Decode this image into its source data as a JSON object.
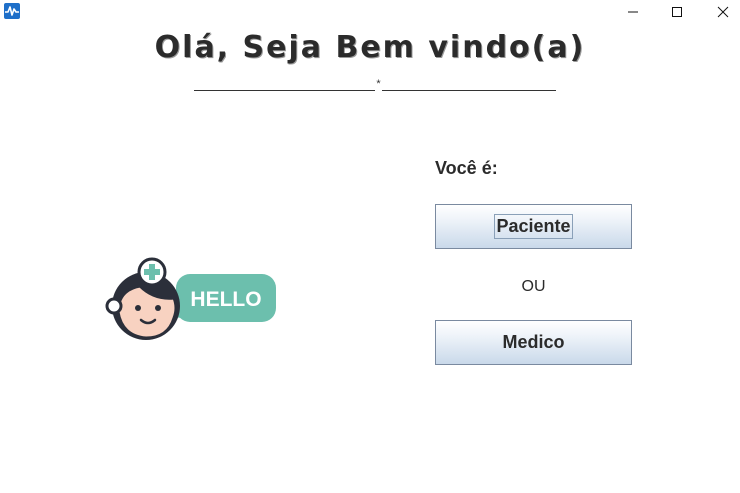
{
  "window": {
    "controls": {
      "minimize_icon": "minimize-icon",
      "maximize_icon": "maximize-icon",
      "close_icon": "close-icon"
    },
    "app_icon": "activity-pulse-icon"
  },
  "header": {
    "title": "Olá, Seja Bem vindo(a)",
    "divider_symbol": "*"
  },
  "illustration": {
    "badge_text": "HELLO",
    "colors": {
      "badge": "#6cbfad",
      "face": "#f8d2c1",
      "hair": "#2b2f3a",
      "cross": "#6cbfad"
    }
  },
  "selection": {
    "prompt": "Você é:",
    "patient_button": "Paciente",
    "or_text": "OU",
    "doctor_button": "Medico"
  },
  "colors": {
    "title_text": "#2b2b2b",
    "button_border": "#7a8aa0",
    "button_gradient_bottom": "#c9d9ea"
  }
}
